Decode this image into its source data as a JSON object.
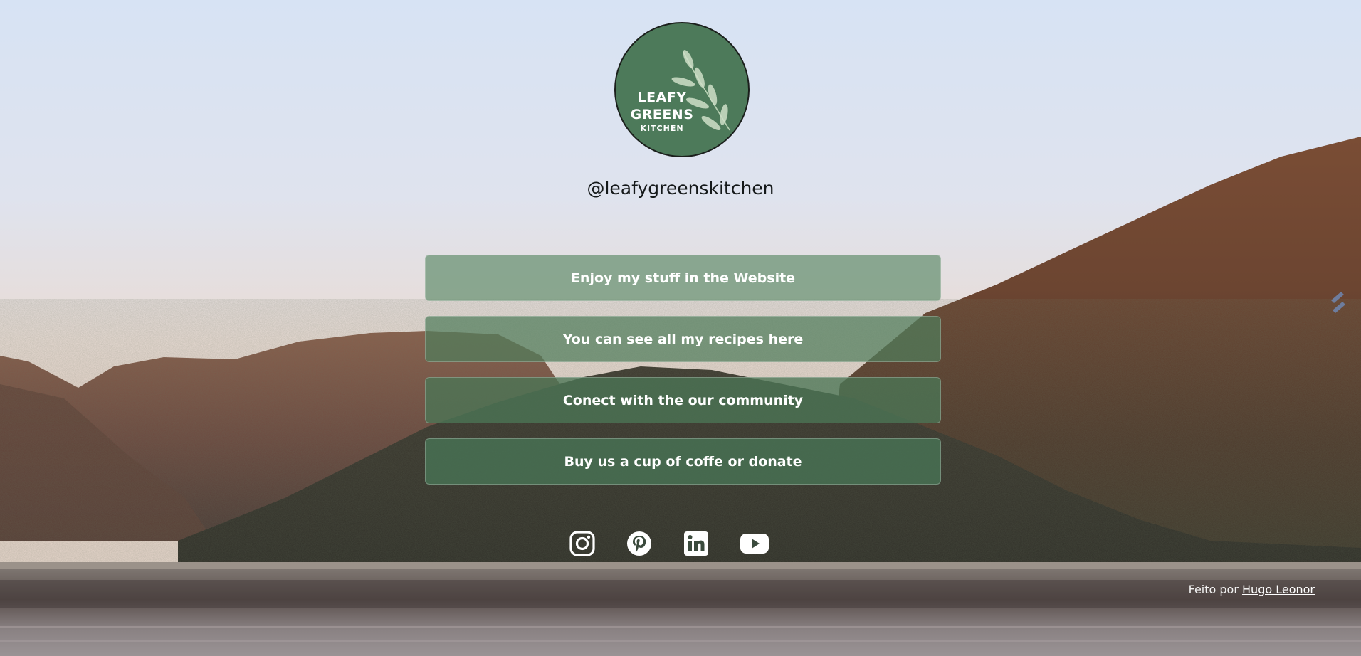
{
  "profile": {
    "logo_alt": "Leafy Greens Kitchen logo",
    "logo_line1": "LEAFY",
    "logo_line2": "GREENS",
    "logo_line3": "KITCHEN",
    "handle": "@leafygreenskitchen"
  },
  "links": [
    {
      "label": "Enjoy my stuff in the Website"
    },
    {
      "label": "You can see all my recipes here"
    },
    {
      "label": "Conect with the our community"
    },
    {
      "label": "Buy us a cup of coffe or donate"
    }
  ],
  "socials": [
    {
      "icon": "instagram-icon"
    },
    {
      "icon": "pinterest-icon"
    },
    {
      "icon": "linkedin-icon"
    },
    {
      "icon": "youtube-icon"
    }
  ],
  "footer": {
    "prefix": "Feito por",
    "author": "Hugo Leonor"
  },
  "colors": {
    "brand_green": "#4d7a5a",
    "button_green": "#4b7656",
    "text_dark": "#15191a"
  }
}
